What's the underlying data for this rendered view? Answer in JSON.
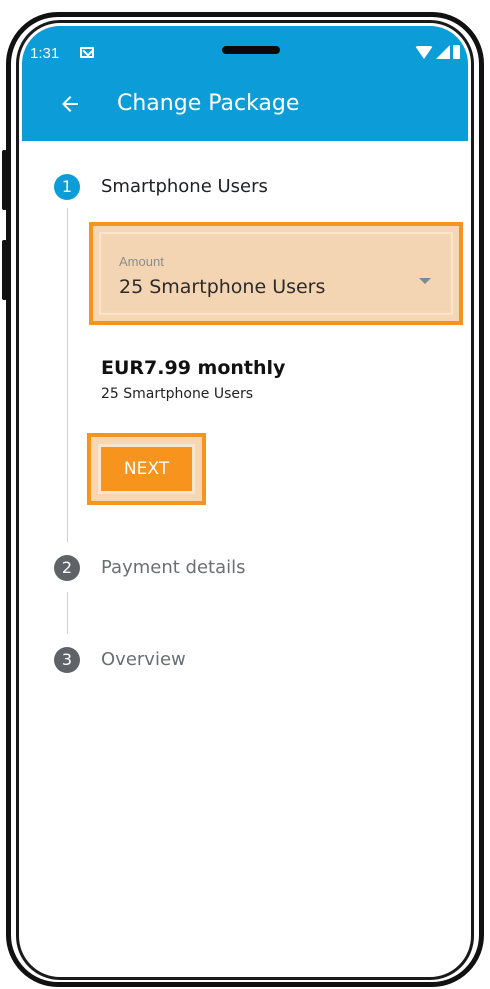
{
  "status_bar": {
    "time": "1:31",
    "mail_icon": "mail-icon",
    "wifi_icon": "wifi-icon",
    "signal_icon": "signal-icon",
    "battery_icon": "battery-icon"
  },
  "app_bar": {
    "title": "Change Package",
    "back_icon": "arrow-left-icon",
    "color": "#0c9dd8"
  },
  "steps": [
    {
      "number": "1",
      "label": "Smartphone Users",
      "state": "active"
    },
    {
      "number": "2",
      "label": "Payment details",
      "state": "inactive"
    },
    {
      "number": "3",
      "label": "Overview",
      "state": "inactive"
    }
  ],
  "amount": {
    "label": "Amount",
    "value": "25 Smartphone Users",
    "dropdown_icon": "caret-down-icon"
  },
  "price": {
    "title": "EUR7.99 monthly",
    "subtitle": "25 Smartphone Users"
  },
  "next_button": {
    "label": "NEXT",
    "color": "#f7941d"
  },
  "highlight_color": "#f7941d"
}
